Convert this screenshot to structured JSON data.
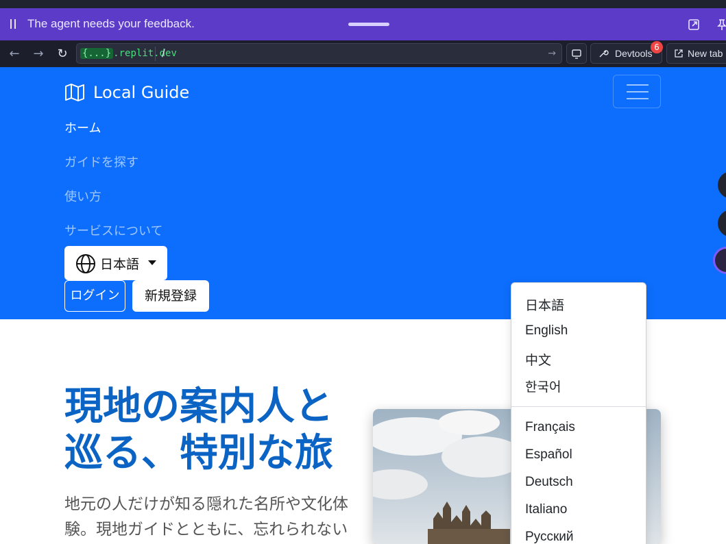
{
  "agent_banner": {
    "message": "The agent needs your feedback."
  },
  "browser": {
    "url_host_badge": "{...}",
    "url_host": ".replit.dev",
    "url_path": "/",
    "devtools_label": "Devtools",
    "devtools_badge": "6",
    "new_tab_label": "New tab"
  },
  "site": {
    "brand": "Local Guide",
    "nav": [
      "ホーム",
      "ガイドを探す",
      "使い方",
      "サービスについて"
    ],
    "language_button": "日本語",
    "login_label": "ログイン",
    "signup_label": "新規登録"
  },
  "language_menu": {
    "primary": [
      "日本語",
      "English",
      "中文",
      "한국어"
    ],
    "secondary": [
      "Français",
      "Español",
      "Deutsch",
      "Italiano",
      "Русский"
    ]
  },
  "hero": {
    "title_line1": "現地の案内人と",
    "title_line2": "巡る、特別な旅",
    "text_line1": "地元の人だけが知る隠れた名所や文化体",
    "text_line2": "験。現地ガイドとともに、忘れられない旅の"
  },
  "colors": {
    "navbar": "#0d6efd",
    "banner": "#5b3bc8",
    "hero_title": "#0b63c4"
  }
}
